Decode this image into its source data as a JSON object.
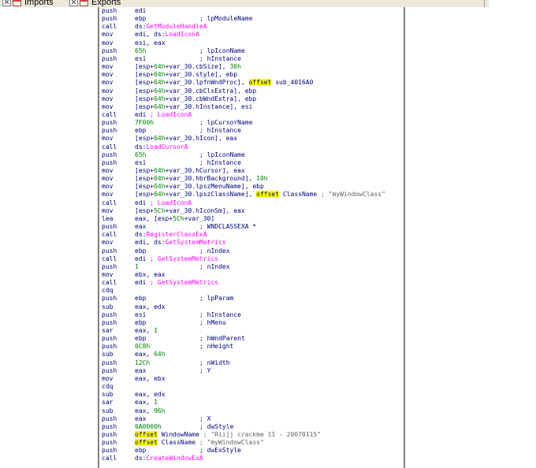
{
  "tabs": [
    {
      "name": "tab-imports",
      "label": "Imports"
    },
    {
      "name": "tab-exports",
      "label": "Exports"
    }
  ],
  "lines": [
    {
      "m": "push",
      "p": [
        {
          "t": "edi"
        }
      ],
      "c": []
    },
    {
      "m": "push",
      "p": [
        {
          "t": "ebp"
        }
      ],
      "c": [
        {
          "t": "; lpModuleName"
        }
      ]
    },
    {
      "m": "call",
      "p": [
        {
          "t": "ds:"
        },
        {
          "t": "GetModuleHandleA",
          "k": "api"
        }
      ],
      "c": []
    },
    {
      "m": "mov",
      "p": [
        {
          "t": "edi, ds:"
        },
        {
          "t": "LoadIconA",
          "k": "api"
        }
      ],
      "c": []
    },
    {
      "m": "mov",
      "p": [
        {
          "t": "esi, eax"
        }
      ],
      "c": []
    },
    {
      "m": "push",
      "p": [
        {
          "t": "65h",
          "k": "num"
        }
      ],
      "c": [
        {
          "t": "; lpIconName"
        }
      ]
    },
    {
      "m": "push",
      "p": [
        {
          "t": "esi"
        }
      ],
      "c": [
        {
          "t": "; hInstance"
        }
      ]
    },
    {
      "m": "mov",
      "p": [
        {
          "t": "[esp+"
        },
        {
          "t": "64h",
          "k": "num"
        },
        {
          "t": "+var_30.cbSize], "
        },
        {
          "t": "30h",
          "k": "num"
        }
      ],
      "c": []
    },
    {
      "m": "mov",
      "p": [
        {
          "t": "[esp+"
        },
        {
          "t": "64h",
          "k": "num"
        },
        {
          "t": "+var_30.style], ebp"
        }
      ],
      "c": []
    },
    {
      "m": "mov",
      "p": [
        {
          "t": "[esp+"
        },
        {
          "t": "64h",
          "k": "num"
        },
        {
          "t": "+var_30.lpfnWndProc], "
        },
        {
          "t": "offset",
          "k": "kw"
        },
        {
          "t": " sub_4016A0"
        }
      ],
      "c": []
    },
    {
      "m": "mov",
      "p": [
        {
          "t": "[esp+"
        },
        {
          "t": "64h",
          "k": "num"
        },
        {
          "t": "+var_30.cbClsExtra], ebp"
        }
      ],
      "c": []
    },
    {
      "m": "mov",
      "p": [
        {
          "t": "[esp+"
        },
        {
          "t": "64h",
          "k": "num"
        },
        {
          "t": "+var_30.cbWndExtra], ebp"
        }
      ],
      "c": []
    },
    {
      "m": "mov",
      "p": [
        {
          "t": "[esp+"
        },
        {
          "t": "64h",
          "k": "num"
        },
        {
          "t": "+var_30.hInstance], esi"
        }
      ],
      "c": []
    },
    {
      "m": "call",
      "p": [
        {
          "t": "edi "
        },
        {
          "t": "; LoadIconA",
          "k": "api"
        }
      ],
      "c": []
    },
    {
      "m": "push",
      "p": [
        {
          "t": "7F00h",
          "k": "num"
        }
      ],
      "c": [
        {
          "t": "; lpCursorName"
        }
      ]
    },
    {
      "m": "push",
      "p": [
        {
          "t": "ebp"
        }
      ],
      "c": [
        {
          "t": "; hInstance"
        }
      ]
    },
    {
      "m": "mov",
      "p": [
        {
          "t": "[esp+"
        },
        {
          "t": "64h",
          "k": "num"
        },
        {
          "t": "+var_30.hIcon], eax"
        }
      ],
      "c": []
    },
    {
      "m": "call",
      "p": [
        {
          "t": "ds:"
        },
        {
          "t": "LoadCursorA",
          "k": "api"
        }
      ],
      "c": []
    },
    {
      "m": "push",
      "p": [
        {
          "t": "65h",
          "k": "num"
        }
      ],
      "c": [
        {
          "t": "; lpIconName"
        }
      ]
    },
    {
      "m": "push",
      "p": [
        {
          "t": "esi"
        }
      ],
      "c": [
        {
          "t": "; hInstance"
        }
      ]
    },
    {
      "m": "mov",
      "p": [
        {
          "t": "[esp+"
        },
        {
          "t": "64h",
          "k": "num"
        },
        {
          "t": "+var_30.hCursor], eax"
        }
      ],
      "c": []
    },
    {
      "m": "mov",
      "p": [
        {
          "t": "[esp+"
        },
        {
          "t": "64h",
          "k": "num"
        },
        {
          "t": "+var_30.hbrBackground], "
        },
        {
          "t": "10h",
          "k": "num"
        }
      ],
      "c": []
    },
    {
      "m": "mov",
      "p": [
        {
          "t": "[esp+"
        },
        {
          "t": "64h",
          "k": "num"
        },
        {
          "t": "+var_30.lpszMenuName], ebp"
        }
      ],
      "c": []
    },
    {
      "m": "mov",
      "p": [
        {
          "t": "[esp+"
        },
        {
          "t": "64h",
          "k": "num"
        },
        {
          "t": "+var_30.lpszClassName], "
        },
        {
          "t": "offset",
          "k": "kw"
        },
        {
          "t": " ClassName "
        },
        {
          "t": "; \"myWindowClass\"",
          "k": "str"
        }
      ],
      "c": []
    },
    {
      "m": "call",
      "p": [
        {
          "t": "edi "
        },
        {
          "t": "; LoadIconA",
          "k": "api"
        }
      ],
      "c": []
    },
    {
      "m": "mov",
      "p": [
        {
          "t": "[esp+"
        },
        {
          "t": "5Ch",
          "k": "num"
        },
        {
          "t": "+var_30.hIconSm], eax"
        }
      ],
      "c": []
    },
    {
      "m": "lea",
      "p": [
        {
          "t": "eax, [esp+"
        },
        {
          "t": "5Ch",
          "k": "num"
        },
        {
          "t": "+var_30]"
        }
      ],
      "c": []
    },
    {
      "m": "push",
      "p": [
        {
          "t": "eax"
        }
      ],
      "c": [
        {
          "t": "; WNDCLASSEXA *"
        }
      ]
    },
    {
      "m": "call",
      "p": [
        {
          "t": "ds:"
        },
        {
          "t": "RegisterClassExA",
          "k": "api"
        }
      ],
      "c": []
    },
    {
      "m": "mov",
      "p": [
        {
          "t": "edi, ds:"
        },
        {
          "t": "GetSystemMetrics",
          "k": "api"
        }
      ],
      "c": []
    },
    {
      "m": "push",
      "p": [
        {
          "t": "ebp"
        }
      ],
      "c": [
        {
          "t": "; nIndex"
        }
      ]
    },
    {
      "m": "call",
      "p": [
        {
          "t": "edi "
        },
        {
          "t": "; GetSystemMetrics",
          "k": "api"
        }
      ],
      "c": []
    },
    {
      "m": "push",
      "p": [
        {
          "t": "1",
          "k": "num"
        }
      ],
      "c": [
        {
          "t": "; nIndex"
        }
      ]
    },
    {
      "m": "mov",
      "p": [
        {
          "t": "ebx, eax"
        }
      ],
      "c": []
    },
    {
      "m": "call",
      "p": [
        {
          "t": "edi "
        },
        {
          "t": "; GetSystemMetrics",
          "k": "api"
        }
      ],
      "c": []
    },
    {
      "m": "cdq",
      "p": [],
      "c": []
    },
    {
      "m": "push",
      "p": [
        {
          "t": "ebp"
        }
      ],
      "c": [
        {
          "t": "; lpParam"
        }
      ]
    },
    {
      "m": "sub",
      "p": [
        {
          "t": "eax, edx"
        }
      ],
      "c": []
    },
    {
      "m": "push",
      "p": [
        {
          "t": "esi"
        }
      ],
      "c": [
        {
          "t": "; hInstance"
        }
      ]
    },
    {
      "m": "push",
      "p": [
        {
          "t": "ebp"
        }
      ],
      "c": [
        {
          "t": "; hMenu"
        }
      ]
    },
    {
      "m": "sar",
      "p": [
        {
          "t": "eax, "
        },
        {
          "t": "1",
          "k": "num"
        }
      ],
      "c": []
    },
    {
      "m": "push",
      "p": [
        {
          "t": "ebp"
        }
      ],
      "c": [
        {
          "t": "; hWndParent"
        }
      ]
    },
    {
      "m": "push",
      "p": [
        {
          "t": "0C8h",
          "k": "num"
        }
      ],
      "c": [
        {
          "t": "; nHeight"
        }
      ]
    },
    {
      "m": "sub",
      "p": [
        {
          "t": "eax, "
        },
        {
          "t": "64h",
          "k": "num"
        }
      ],
      "c": []
    },
    {
      "m": "push",
      "p": [
        {
          "t": "12Ch",
          "k": "num"
        }
      ],
      "c": [
        {
          "t": "; nWidth"
        }
      ]
    },
    {
      "m": "push",
      "p": [
        {
          "t": "eax"
        }
      ],
      "c": [
        {
          "t": "; Y"
        }
      ]
    },
    {
      "m": "mov",
      "p": [
        {
          "t": "eax, ebx"
        }
      ],
      "c": []
    },
    {
      "m": "cdq",
      "p": [],
      "c": []
    },
    {
      "m": "sub",
      "p": [
        {
          "t": "eax, edx"
        }
      ],
      "c": []
    },
    {
      "m": "sar",
      "p": [
        {
          "t": "eax, "
        },
        {
          "t": "1",
          "k": "num"
        }
      ],
      "c": []
    },
    {
      "m": "sub",
      "p": [
        {
          "t": "eax, "
        },
        {
          "t": "96h",
          "k": "num"
        }
      ],
      "c": []
    },
    {
      "m": "push",
      "p": [
        {
          "t": "eax"
        }
      ],
      "c": [
        {
          "t": "; X"
        }
      ]
    },
    {
      "m": "push",
      "p": [
        {
          "t": "0A0000h",
          "k": "num"
        }
      ],
      "c": [
        {
          "t": "; dwStyle"
        }
      ]
    },
    {
      "m": "push",
      "p": [
        {
          "t": "offset",
          "k": "kw"
        },
        {
          "t": " WindowName "
        },
        {
          "t": "; \"Riijj crackme 11 - 20070115\"",
          "k": "str"
        }
      ],
      "c": []
    },
    {
      "m": "push",
      "p": [
        {
          "t": "offset",
          "k": "kw"
        },
        {
          "t": " ClassName "
        },
        {
          "t": "; \"myWindowClass\"",
          "k": "str"
        }
      ],
      "c": []
    },
    {
      "m": "push",
      "p": [
        {
          "t": "ebp"
        }
      ],
      "c": [
        {
          "t": "; dwExStyle"
        }
      ]
    },
    {
      "m": "call",
      "p": [
        {
          "t": "ds:"
        },
        {
          "t": "CreateWindowExA",
          "k": "api"
        }
      ],
      "c": []
    }
  ]
}
